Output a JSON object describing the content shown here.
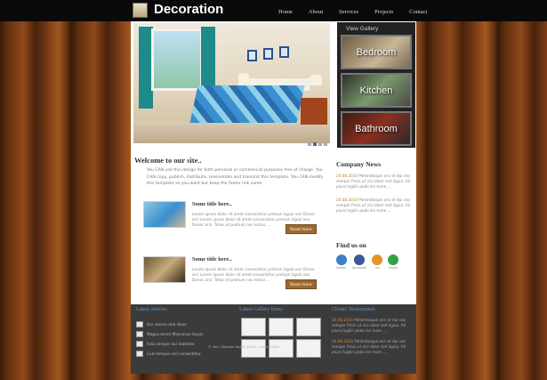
{
  "header": {
    "logo_text": "Decoration",
    "nav": [
      "Home",
      "About",
      "Services",
      "Projects",
      "Contact"
    ]
  },
  "gallery": {
    "title": "View Gallery",
    "items": [
      "Bedroom",
      "Kitchen",
      "Bathroom"
    ]
  },
  "main": {
    "welcome_title": "Welcome to our site..",
    "intro": "You CAN use this design for both personal or commercial purposes free of charge. You CAN copy, publish, distribute, reassemble and transmit this template. You CAN modify this template as you want but keep the footer link same.",
    "posts": [
      {
        "title": "Some title here..",
        "text": "Lorem ipsum dolor sit amet consectetur pretium ligula non Donec orci Lorem ipsum dolor sit amet consectetur pretium ligula non Donec orci. Tellus et pretium nec lectus ...",
        "button": "Read more"
      },
      {
        "title": "Some title here..",
        "text": "Lorem ipsum dolor sit amet consectetur pretium ligula non Donec orci Lorem ipsum dolor sit amet consectetur pretium ligula non Donec orci. Tellus et pretium nec lectus ...",
        "button": "Read more"
      }
    ]
  },
  "sidebar": {
    "news_title": "Company News",
    "news": [
      {
        "date": "20.08.2010",
        "text": "Pellentesque orci et dui nec semper Proin ut nisi dolor sed ligula. Ali plura fugilin pedo les more ..."
      },
      {
        "date": "20.08.2010",
        "text": "Pellentesque orci et dui nec semper Proin ut nisi dolor sed ligula. Ali plura fugilin pedo les more ..."
      }
    ],
    "find_title": "Find us on",
    "social": [
      {
        "name": "twitter",
        "color": "#3d7fc4"
      },
      {
        "name": "facebook",
        "color": "#3b5998"
      },
      {
        "name": "rss",
        "color": "#e89425"
      },
      {
        "name": "skype",
        "color": "#35a14a"
      }
    ]
  },
  "footer": {
    "articles_title": "Latest Articles",
    "articles": [
      "Our stories and ideas",
      "Magna lorem Maecenas turpis",
      "Felis semper dui molestie",
      "Cum tempor nisl consectetur"
    ],
    "gallery_title": "Latest Gallery Items",
    "testimonials_title": "Clients Testimonials",
    "testimonials": [
      {
        "date": "20.08.2010",
        "text": "Pellentesque orci et dui nec semper Proin ut nisi dolor sed ligula. Ali plura fugilin pedo les more ..."
      },
      {
        "date": "20.08.2010",
        "text": "Pellentesque orci et dui nec semper Proin ut nisi dolor sed ligula. Ali plura fugilin pedo les more ..."
      }
    ],
    "copyright": "© Your Website Name 2010. | Coded from ..."
  }
}
